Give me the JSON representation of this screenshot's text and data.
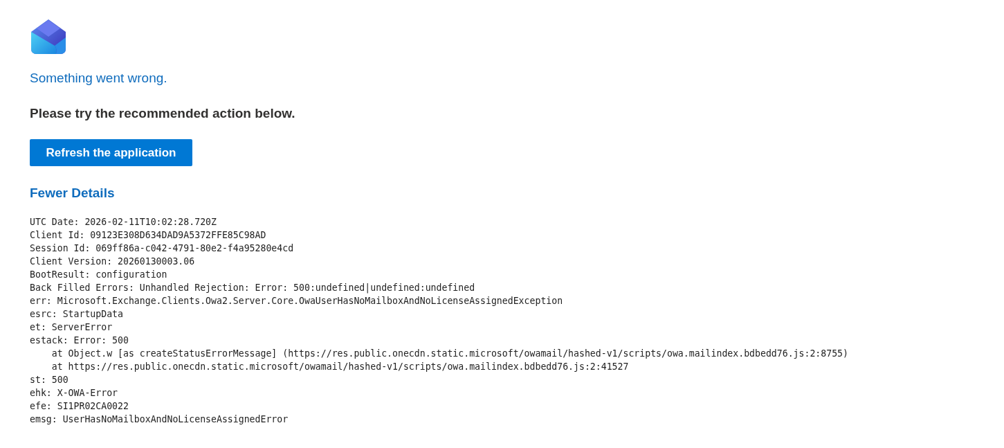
{
  "title": "Something went wrong.",
  "instruction": "Please try the recommended action below.",
  "action_button": "Refresh the application",
  "details_toggle": "Fewer Details",
  "details": [
    "UTC Date: 2026-02-11T10:02:28.720Z",
    "Client Id: 09123E308D634DAD9A5372FFE85C98AD",
    "Session Id: 069ff86a-c042-4791-80e2-f4a95280e4cd",
    "Client Version: 20260130003.06",
    "BootResult: configuration",
    "Back Filled Errors: Unhandled Rejection: Error: 500:undefined|undefined:undefined",
    "err: Microsoft.Exchange.Clients.Owa2.Server.Core.OwaUserHasNoMailboxAndNoLicenseAssignedException",
    "esrc: StartupData",
    "et: ServerError",
    "estack: Error: 500",
    "    at Object.w [as createStatusErrorMessage] (https://res.public.onecdn.static.microsoft/owamail/hashed-v1/scripts/owa.mailindex.bdbedd76.js:2:8755)",
    "    at https://res.public.onecdn.static.microsoft/owamail/hashed-v1/scripts/owa.mailindex.bdbedd76.js:2:41527",
    "st: 500",
    "ehk: X-OWA-Error",
    "efe: SI1PR02CA0022",
    "emsg: UserHasNoMailboxAndNoLicenseAssignedError"
  ]
}
